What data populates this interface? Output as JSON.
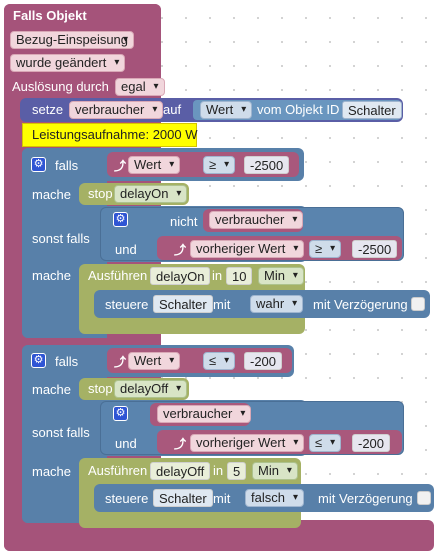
{
  "trigger": {
    "title": "Falls Objekt",
    "object": "Bezug-Einspeisung",
    "condition": "wurde geändert",
    "trigger_label": "Auslösung durch",
    "trigger_value": "egal"
  },
  "setvar": {
    "prefix": "setze",
    "variable": "verbraucher",
    "on": "auf",
    "value_dd": "Wert",
    "from_label": "vom Objekt ID",
    "object_id": "Schalter"
  },
  "tooltip": "Leistungsaufnahme: 2000 W",
  "if1": {
    "falls": "falls",
    "value_dd": "Wert",
    "op": "≥",
    "num": "-2500",
    "mache": "mache",
    "stop_label": "stop",
    "stop_value": "delayOn",
    "sonst_falls": "sonst falls",
    "not_label": "nicht",
    "var": "verbraucher",
    "und": "und",
    "prev_value": "vorheriger Wert",
    "op2": "≥",
    "num2": "-2500",
    "mache2": "mache",
    "exec_label": "Ausführen",
    "exec_name": "delayOn",
    "in_label": "in",
    "time": "10",
    "unit": "Min",
    "control_label": "steuere",
    "control_obj": "Schalter",
    "with": "mit",
    "control_val": "wahr",
    "delay_label": "mit Verzögerung"
  },
  "if2": {
    "falls": "falls",
    "value_dd": "Wert",
    "op": "≤",
    "num": "-200",
    "mache": "mache",
    "stop_label": "stop",
    "stop_value": "delayOff",
    "sonst_falls": "sonst falls",
    "var": "verbraucher",
    "und": "und",
    "prev_value": "vorheriger Wert",
    "op2": "≤",
    "num2": "-200",
    "mache2": "mache",
    "exec_label": "Ausführen",
    "exec_name": "delayOff",
    "in_label": "in",
    "time": "5",
    "unit": "Min",
    "control_label": "steuere",
    "control_obj": "Schalter",
    "with": "mit",
    "control_val": "falsch",
    "delay_label": "mit Verzögerung"
  },
  "icons": {
    "gear": "gear-icon",
    "ref": "reference-arrow-icon"
  },
  "colors": {
    "trigger": "#a5537a",
    "logic": "#5880a9",
    "event": "#a9587c",
    "timer": "#a5b165",
    "tooltip": "#ffff00"
  }
}
